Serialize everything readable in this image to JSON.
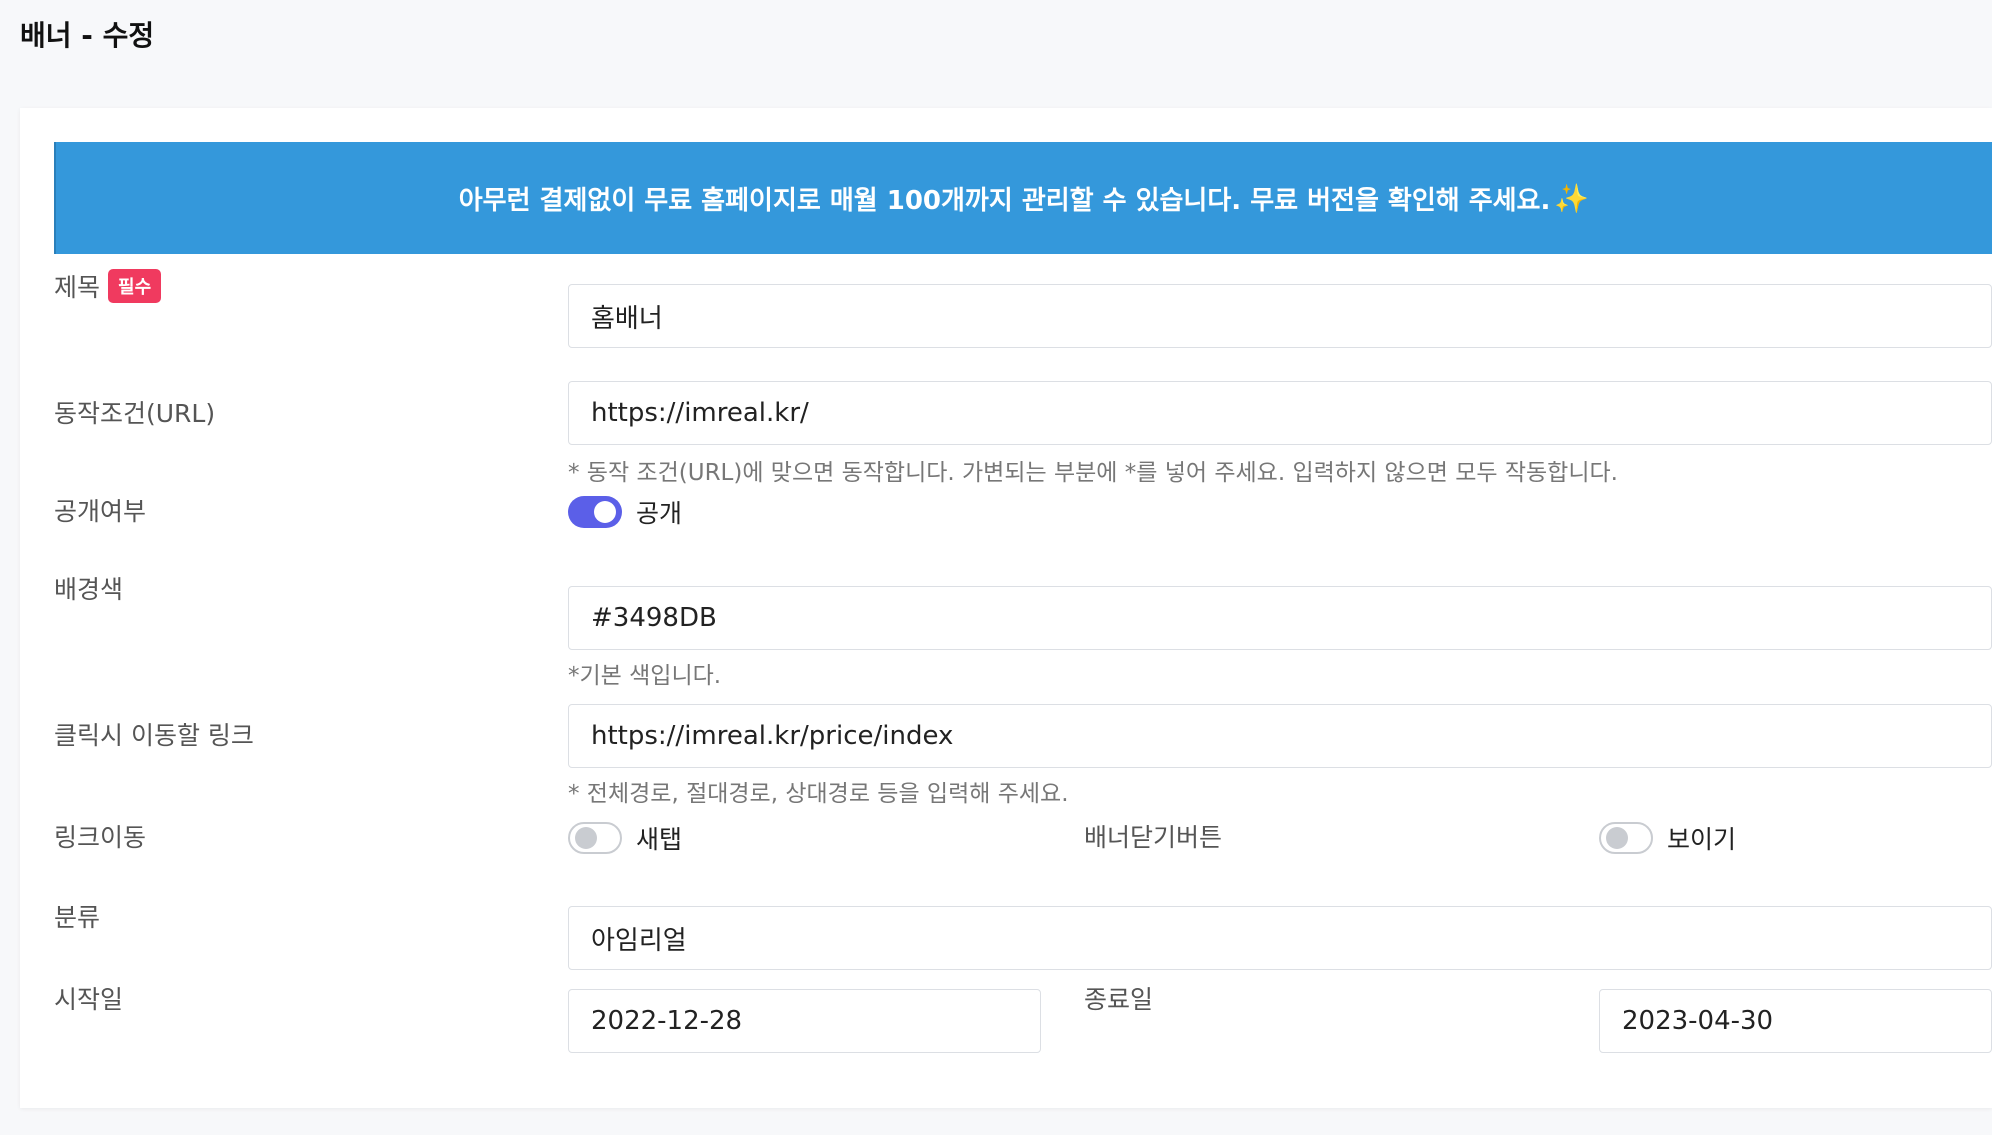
{
  "page": {
    "title": "배너 - 수정"
  },
  "notice": {
    "text": "아무런 결제없이 무료 홈페이지로 매월 100개까지 관리할 수 있습니다. 무료 버전을 확인해 주세요.",
    "sparkle": "✨",
    "background_color": "#3498DB"
  },
  "form": {
    "title": {
      "label": "제목",
      "required_badge": "필수",
      "value": "홈배너"
    },
    "url_condition": {
      "label": "동작조건(URL)",
      "value": "https://imreal.kr/",
      "hint": "* 동작 조건(URL)에 맞으면 동작합니다. 가변되는 부분에 *를 넣어 주세요. 입력하지 않으면 모두 작동합니다."
    },
    "visibility": {
      "label": "공개여부",
      "toggle_label": "공개",
      "enabled": true
    },
    "background_color": {
      "label": "배경색",
      "value": "#3498DB",
      "hint": "*기본 색입니다."
    },
    "click_link": {
      "label": "클릭시 이동할 링크",
      "value": "https://imreal.kr/price/index",
      "hint": "* 전체경로, 절대경로, 상대경로 등을 입력해 주세요."
    },
    "link_target": {
      "label": "링크이동",
      "toggle_label": "새탭",
      "enabled": false
    },
    "close_button": {
      "label": "배너닫기버튼",
      "toggle_label": "보이기",
      "enabled": false
    },
    "category": {
      "label": "분류",
      "value": "아임리얼"
    },
    "start_date": {
      "label": "시작일",
      "value": "2022-12-28"
    },
    "end_date": {
      "label": "종료일",
      "value": "2023-04-30"
    }
  },
  "colors": {
    "toggle_on": "#5b5fe8",
    "required_badge": "#f03a5f"
  }
}
